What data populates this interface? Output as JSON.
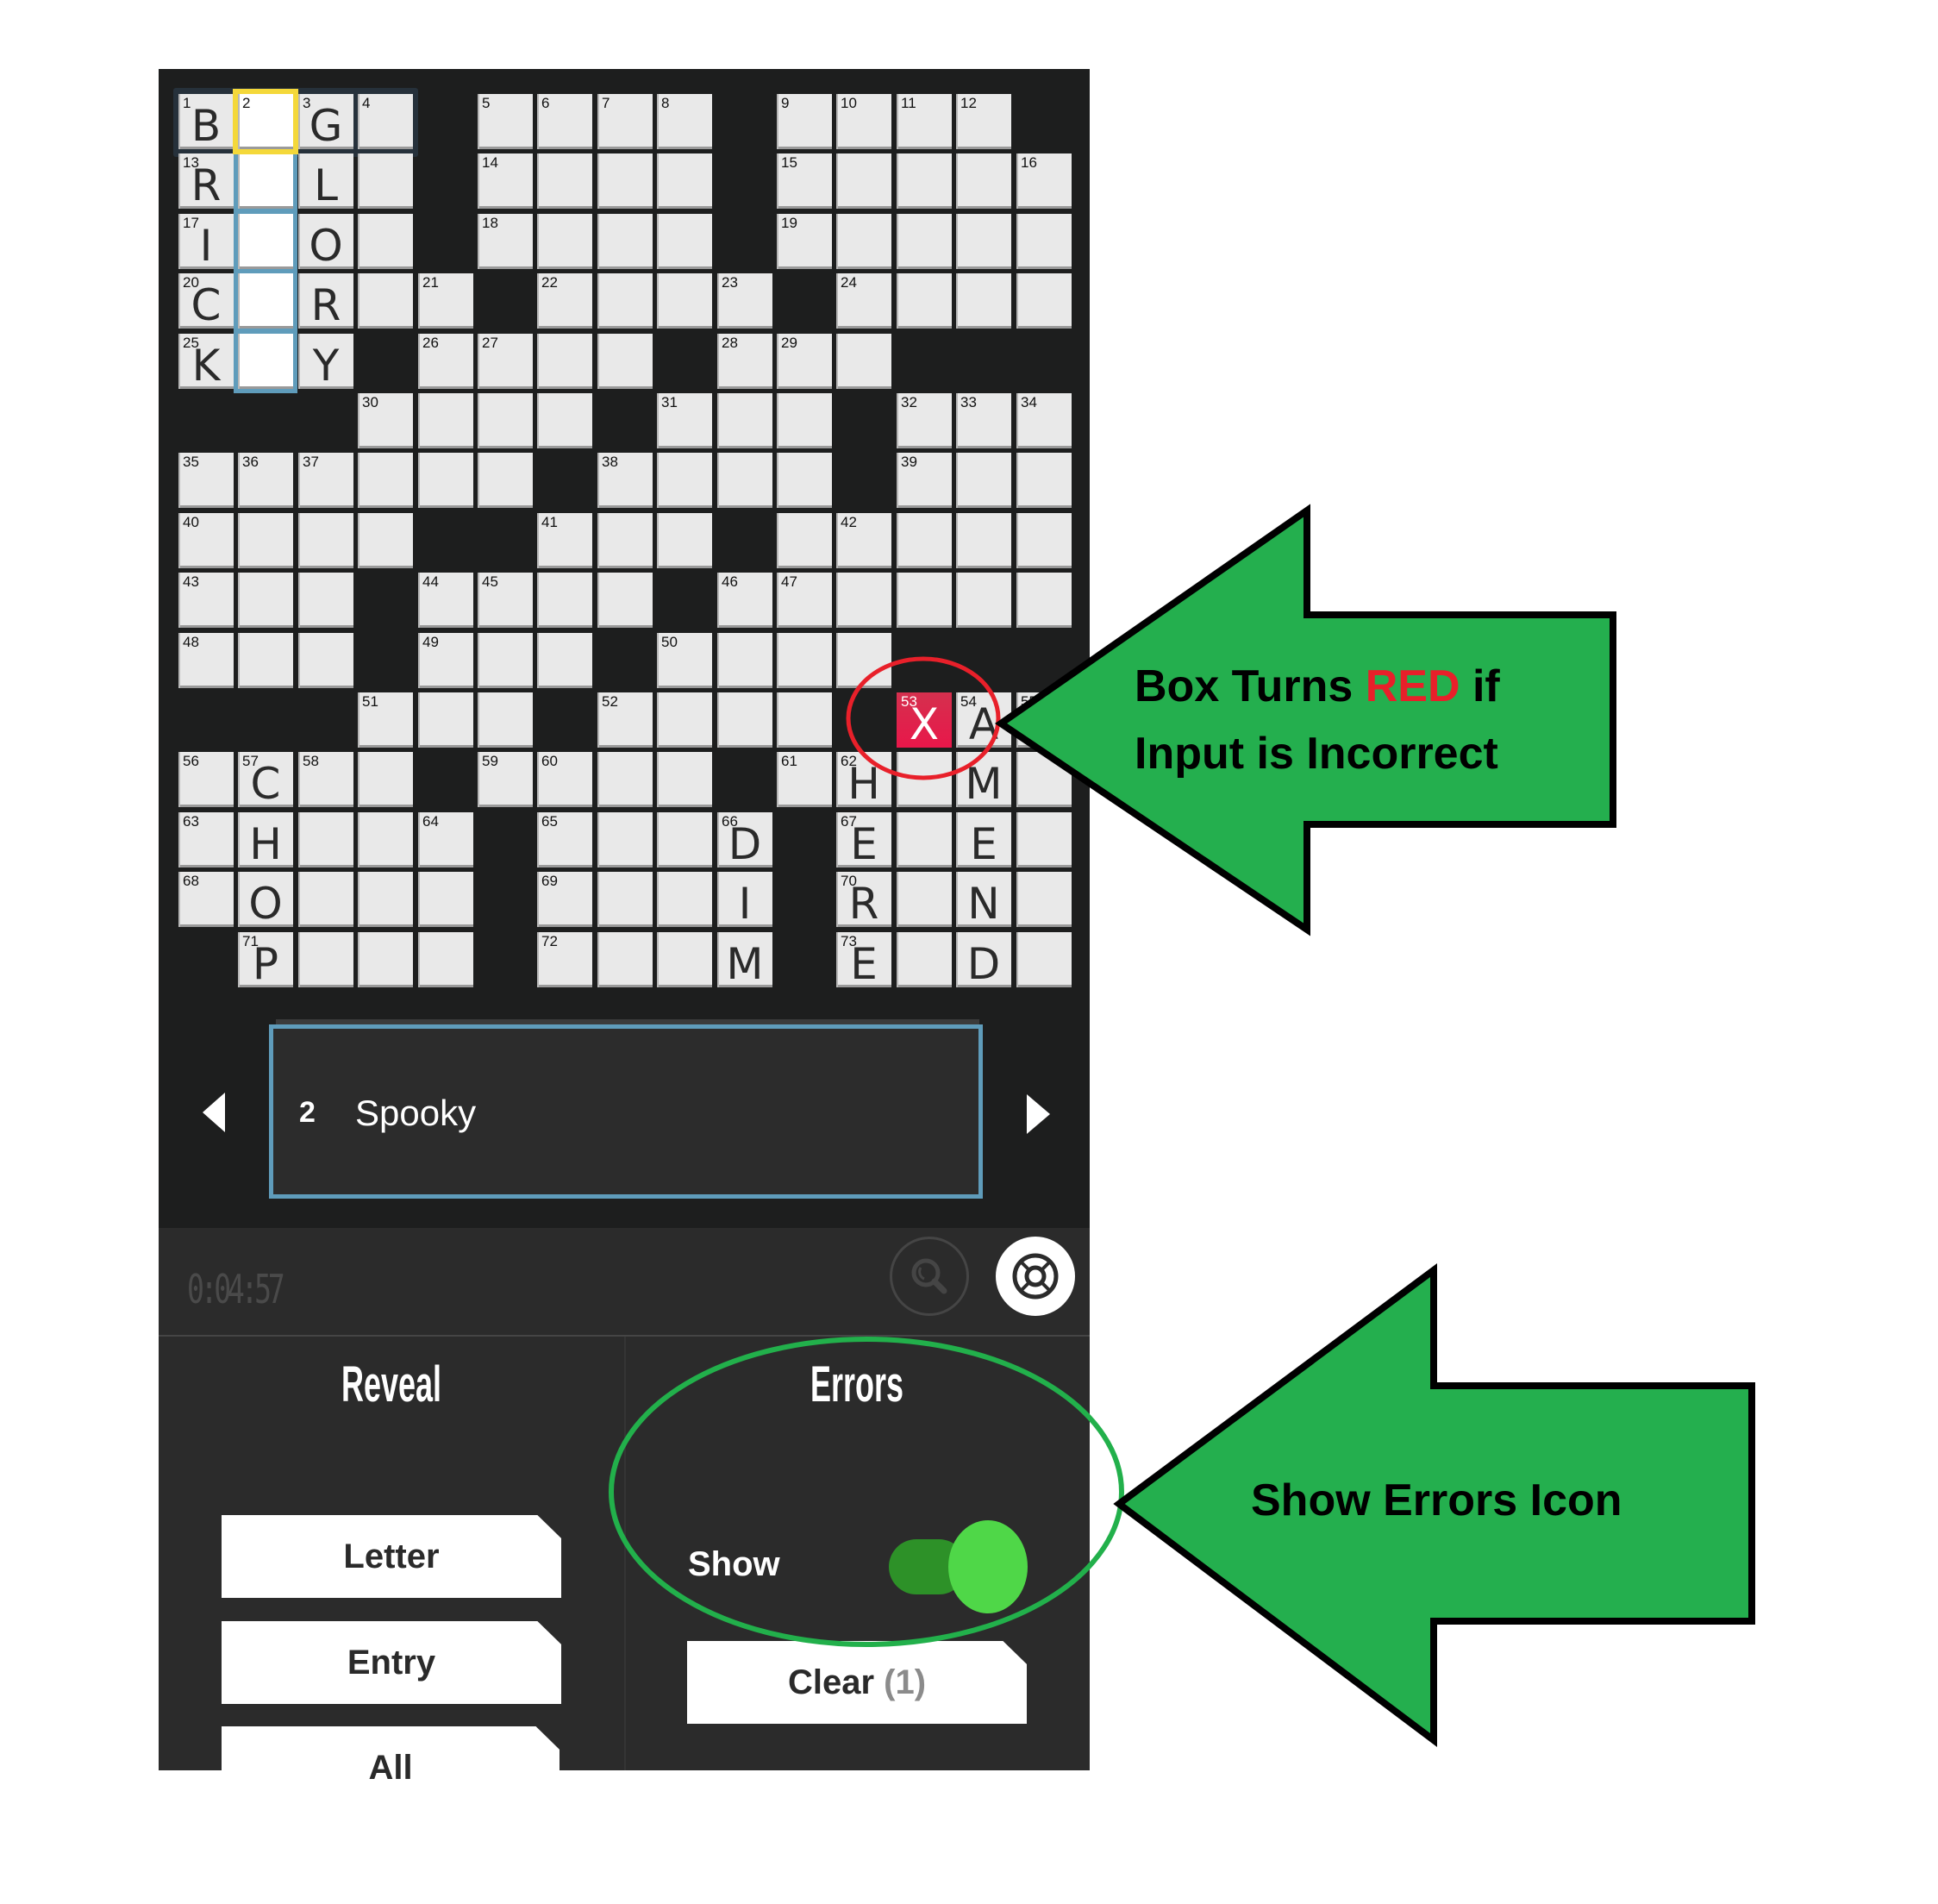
{
  "puzzle": {
    "grid": [
      [
        "1",
        "2",
        "3",
        "4",
        "#",
        "5",
        "6",
        "7",
        "8",
        "#",
        "9",
        "10",
        "11",
        "12",
        "#"
      ],
      [
        "13",
        "",
        "",
        "",
        "#",
        "14",
        "",
        "",
        "",
        "#",
        "15",
        "",
        "",
        "",
        "16"
      ],
      [
        "17",
        "",
        "",
        "",
        "#",
        "18",
        "",
        "",
        "",
        "#",
        "19",
        "",
        "",
        "",
        ""
      ],
      [
        "20",
        "",
        "",
        "",
        "21",
        "#",
        "22",
        "",
        "",
        "23",
        "#",
        "24",
        "",
        "",
        ""
      ],
      [
        "25",
        "",
        "",
        "#",
        "26",
        "27",
        "",
        "",
        "#",
        "28",
        "29",
        "",
        "#",
        "#",
        "#"
      ],
      [
        "#",
        "#",
        "#",
        "30",
        "",
        "",
        "",
        "#",
        "31",
        "",
        "",
        "#",
        "32",
        "33",
        "34"
      ],
      [
        "35",
        "36",
        "37",
        "",
        "",
        "",
        "#",
        "38",
        "",
        "",
        "",
        "#",
        "39",
        "",
        ""
      ],
      [
        "40",
        "",
        "",
        "",
        "#",
        "#",
        "41",
        "",
        "",
        "#",
        "",
        "42",
        "",
        "",
        ""
      ],
      [
        "43",
        "",
        "",
        "#",
        "44",
        "45",
        "",
        "",
        "#",
        "46",
        "47",
        "",
        "",
        "",
        ""
      ],
      [
        "48",
        "",
        "",
        "#",
        "49",
        "",
        "",
        "#",
        "50",
        "",
        "",
        "",
        "#",
        "#",
        "#"
      ],
      [
        "#",
        "#",
        "#",
        "51",
        "",
        "",
        "#",
        "52",
        "",
        "",
        "",
        "#",
        "53",
        "54",
        "55"
      ],
      [
        "56",
        "57",
        "58",
        "",
        "#",
        "59",
        "60",
        "",
        "",
        "#",
        "61",
        "62",
        "",
        "",
        ""
      ],
      [
        "63",
        "",
        "",
        "",
        "64",
        "#",
        "65",
        "",
        "",
        "66",
        "#",
        "67",
        "",
        "",
        ""
      ],
      [
        "68",
        "",
        "",
        "",
        "",
        "#",
        "69",
        "",
        "",
        "",
        "#",
        "70",
        "",
        "",
        ""
      ],
      [
        "#",
        "71",
        "",
        "",
        "",
        "#",
        "72",
        "",
        "",
        "",
        "#",
        "73",
        "",
        "",
        ""
      ]
    ],
    "letters": [
      [
        "B",
        "",
        "G",
        "",
        "",
        "",
        "",
        "",
        "",
        "",
        "",
        "",
        "",
        "",
        ""
      ],
      [
        "R",
        "",
        "L",
        "",
        "",
        "",
        "",
        "",
        "",
        "",
        "",
        "",
        "",
        "",
        ""
      ],
      [
        "I",
        "",
        "O",
        "",
        "",
        "",
        "",
        "",
        "",
        "",
        "",
        "",
        "",
        "",
        ""
      ],
      [
        "C",
        "",
        "R",
        "",
        "",
        "",
        "",
        "",
        "",
        "",
        "",
        "",
        "",
        "",
        ""
      ],
      [
        "K",
        "",
        "Y",
        "",
        "",
        "",
        "",
        "",
        "",
        "",
        "",
        "",
        "",
        "",
        ""
      ],
      [
        "",
        "",
        "",
        "",
        "",
        "",
        "",
        "",
        "",
        "",
        "",
        "",
        "",
        "",
        ""
      ],
      [
        "",
        "",
        "",
        "",
        "",
        "",
        "",
        "",
        "",
        "",
        "",
        "",
        "",
        "",
        ""
      ],
      [
        "",
        "",
        "",
        "",
        "",
        "",
        "",
        "",
        "",
        "",
        "",
        "",
        "",
        "",
        ""
      ],
      [
        "",
        "",
        "",
        "",
        "",
        "",
        "",
        "",
        "",
        "",
        "",
        "",
        "",
        "",
        ""
      ],
      [
        "",
        "",
        "",
        "",
        "",
        "",
        "",
        "",
        "",
        "",
        "",
        "",
        "",
        "",
        ""
      ],
      [
        "",
        "",
        "",
        "",
        "",
        "",
        "",
        "",
        "",
        "",
        "",
        "",
        "X",
        "A",
        ""
      ],
      [
        "",
        "C",
        "",
        "",
        "",
        "",
        "",
        "",
        "",
        "",
        "",
        "H",
        "",
        "M",
        ""
      ],
      [
        "",
        "H",
        "",
        "",
        "",
        "",
        "",
        "",
        "",
        "D",
        "",
        "E",
        "",
        "E",
        ""
      ],
      [
        "",
        "O",
        "",
        "",
        "",
        "",
        "",
        "",
        "",
        "I",
        "",
        "R",
        "",
        "N",
        ""
      ],
      [
        "",
        "P",
        "",
        "",
        "",
        "",
        "",
        "",
        "",
        "M",
        "",
        "E",
        "",
        "D",
        ""
      ]
    ],
    "selected_cell": {
      "row": 0,
      "col": 1
    },
    "active_word_cells": [
      [
        1,
        1
      ],
      [
        2,
        1
      ],
      [
        3,
        1
      ],
      [
        4,
        1
      ]
    ],
    "error_cells": [
      [
        10,
        12
      ]
    ],
    "colors": {
      "selected": "#f4d83a",
      "active_word": "#5f9cbb",
      "error": "#e8174a",
      "toggle_on": "#4fd748"
    }
  },
  "clue_bar": {
    "number": "2",
    "text": "Spooky",
    "prev_icon": "triangle-left",
    "next_icon": "triangle-right"
  },
  "toolbar": {
    "timer": "0:04:57",
    "search_icon": "magnifier-icon",
    "help_icon": "lifebuoy-icon"
  },
  "reveal": {
    "title": "Reveal",
    "buttons": [
      "Letter",
      "Entry",
      "All"
    ]
  },
  "errors": {
    "title": "Errors",
    "show_label": "Show",
    "show_enabled": true,
    "clear_label": "Clear",
    "clear_count": "(1)"
  },
  "annotations": {
    "arrow1": {
      "line1_a": "Box Turns ",
      "line1_red": "RED",
      "line1_b": " if",
      "line2": "Input is Incorrect"
    },
    "arrow2": {
      "text": "Show Errors Icon"
    }
  }
}
